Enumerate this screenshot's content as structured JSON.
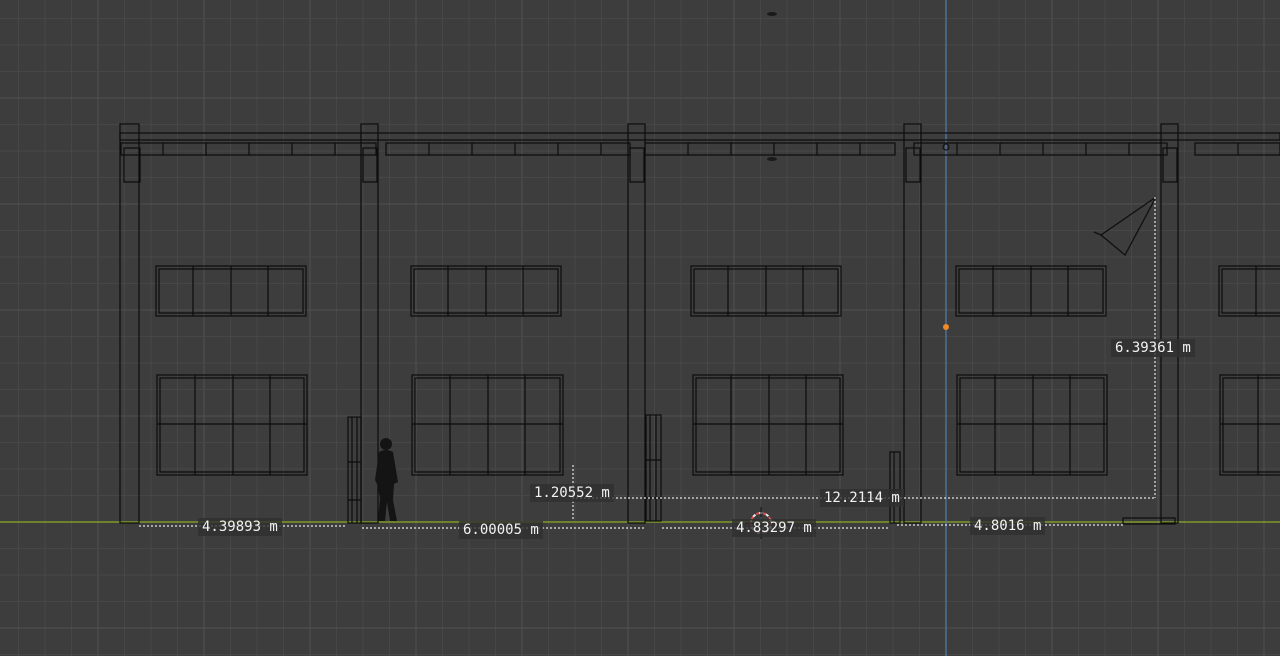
{
  "viewport": {
    "view": "orthographic front",
    "grid": true,
    "colors": {
      "background": "#3d3d3d",
      "grid_minor": "#474747",
      "grid_major": "#515151",
      "wire": "#0c0c0c",
      "ground_axis": "#7f9a2a",
      "z_axis": "#4f7fb0",
      "measure": "#e6e6e6",
      "origin_dot": "#f08a24",
      "cursor_red": "#e05050",
      "cursor_white": "#f0f0f0",
      "silhouette": "#141414"
    },
    "icons": [
      "camera-icon",
      "light-icon",
      "person-silhouette",
      "3d-cursor-icon",
      "origin-dot-icon"
    ]
  },
  "measurements": {
    "bay1": "4.39893 m",
    "bay2": "6.00005 m",
    "bay3": "4.83297 m",
    "bay4": "4.8016 m",
    "door_height": "1.20552 m",
    "span": "12.2114 m",
    "height": "6.39361 m"
  }
}
